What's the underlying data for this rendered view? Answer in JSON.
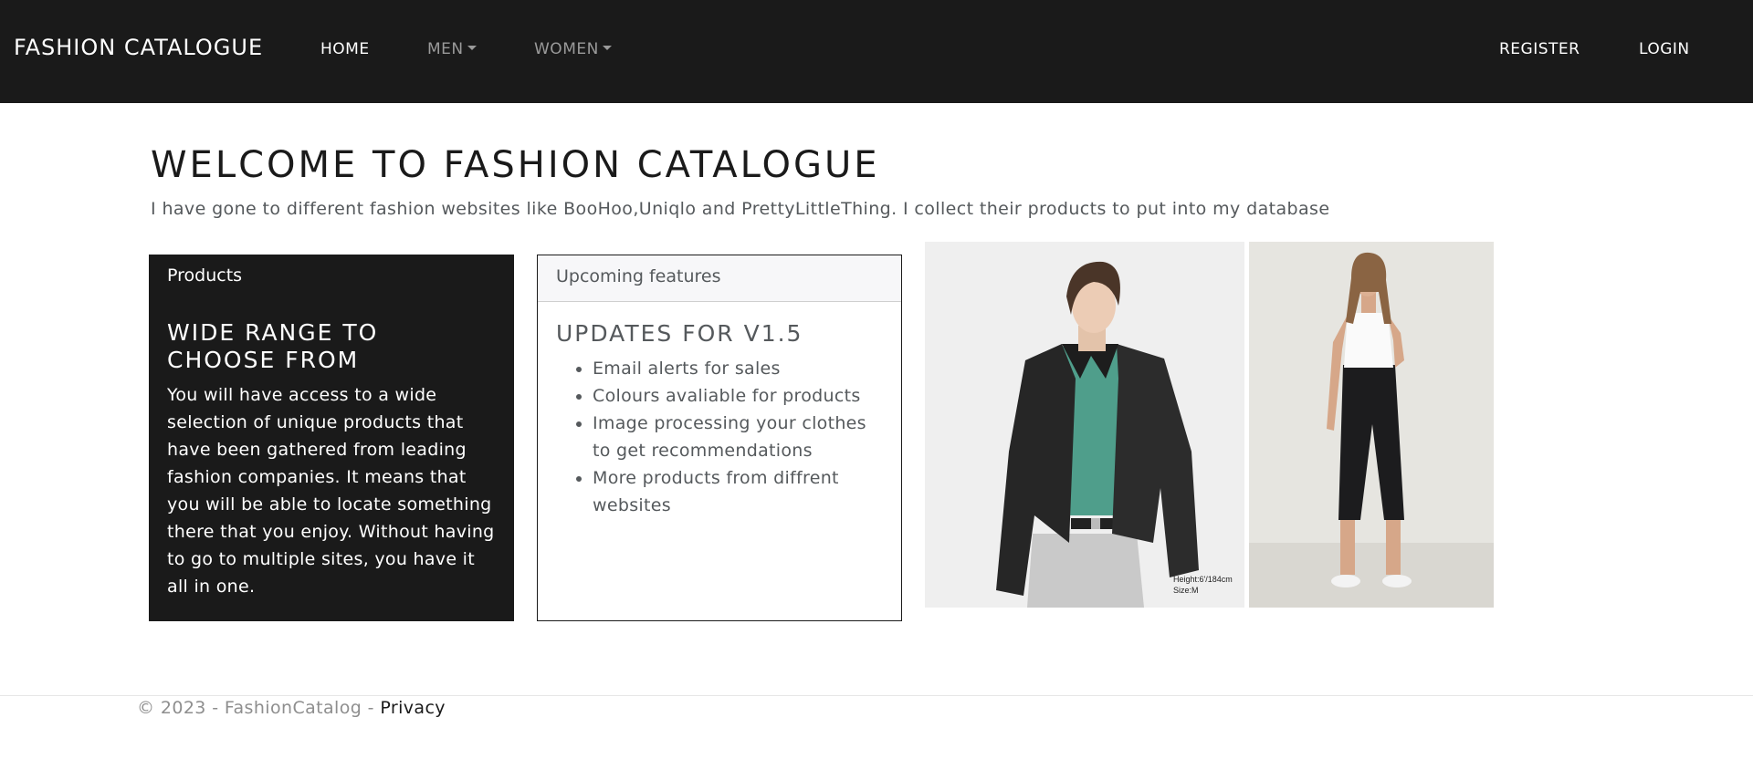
{
  "navbar": {
    "brand": "FASHION CATALOGUE",
    "home": "HOME",
    "men": "MEN",
    "women": "WOMEN",
    "register": "REGISTER",
    "login": "LOGIN"
  },
  "main": {
    "title": "WELCOME TO FASHION CATALOGUE",
    "lead": "I have gone to different fashion websites like BooHoo,Uniqlo and PrettyLittleThing. I collect their products to put into my database"
  },
  "products_card": {
    "header": "Products",
    "title": "WIDE RANGE TO CHOOSE FROM",
    "text": "You will have access to a wide selection of unique products that have been gathered from leading fashion companies. It means that you will be able to locate something there that you enjoy. Without having to go to multiple sites, you have it all in one."
  },
  "features_card": {
    "header": "Upcoming features",
    "title": "UPDATES FOR V1.5",
    "items": [
      "Email alerts for sales",
      "Colours avaliable for products",
      "Image processing your clothes to get recommendations",
      "More products from diffrent websites"
    ]
  },
  "images": {
    "men_caption_1": "Height:6'/184cm",
    "men_caption_2": "Size:M"
  },
  "footer": {
    "text": "© 2023 - FashionCatalog - ",
    "privacy": "Privacy"
  },
  "colors": {
    "navbar_bg": "#1a1a1a",
    "card_dark_bg": "#1a1a1a",
    "muted_text": "#55595c",
    "footer_text": "#8e8e8e"
  }
}
